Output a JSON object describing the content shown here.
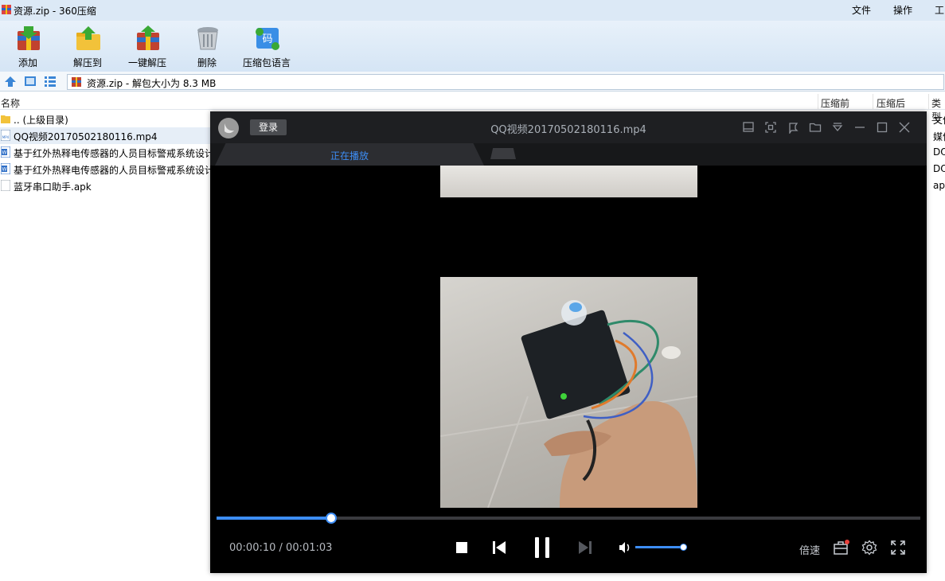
{
  "app": {
    "title": "资源.zip - 360压缩",
    "menu": [
      "文件",
      "操作",
      "工"
    ]
  },
  "toolbar": [
    {
      "label": "添加",
      "icon": "add-archive-icon"
    },
    {
      "label": "解压到",
      "icon": "extract-to-icon"
    },
    {
      "label": "一键解压",
      "icon": "one-click-extract-icon"
    },
    {
      "label": "删除",
      "icon": "trash-icon"
    },
    {
      "label": "压缩包语言",
      "icon": "archive-language-icon",
      "glyph": "码"
    }
  ],
  "address": {
    "text": "资源.zip - 解包大小为 8.3 MB"
  },
  "columns": {
    "name": "名称",
    "before": "压缩前",
    "after": "压缩后",
    "type": "类型"
  },
  "files": [
    {
      "name": ".. (上级目录)",
      "type": "文件",
      "icon": "folder-icon"
    },
    {
      "name": "QQ视频20170502180116.mp4",
      "type": "媒体",
      "icon": "mp4-file-icon"
    },
    {
      "name": "基于红外热释电传感器的人员目标警戒系统设计",
      "type": "DO",
      "icon": "word-doc-icon"
    },
    {
      "name": "基于红外热释电传感器的人员目标警戒系统设计",
      "type": "DO",
      "icon": "word-doc-icon"
    },
    {
      "name": "蓝牙串口助手.apk",
      "type": "ap",
      "icon": "apk-file-icon"
    }
  ],
  "player": {
    "login_label": "登录",
    "title": "QQ视频20170502180116.mp4",
    "tab_playing": "正在播放",
    "current_time": "00:00:10 /",
    "total_time": "00:01:03",
    "progress": 0.163,
    "volume": 0.9,
    "speed_label": "倍速"
  }
}
